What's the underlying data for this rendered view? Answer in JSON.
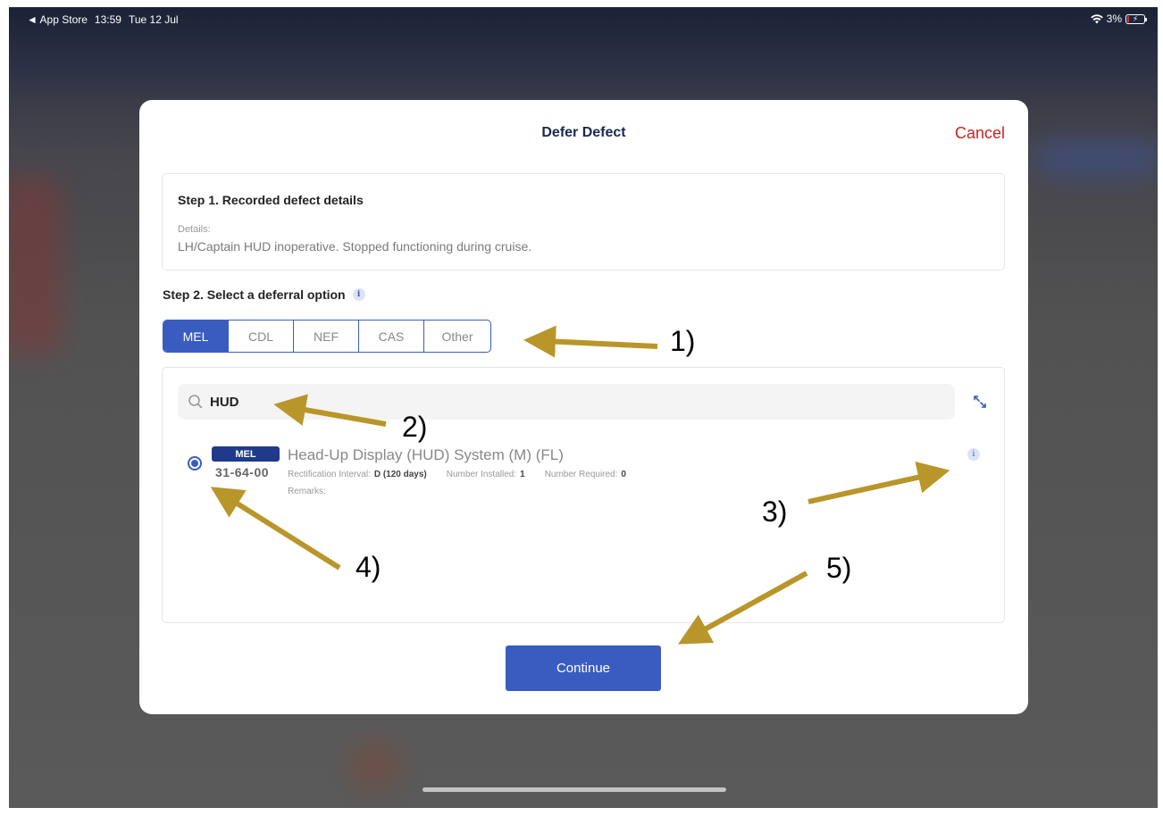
{
  "statusbar": {
    "back_app": "◄ App Store",
    "time": "13:59",
    "date": "Tue 12 Jul",
    "battery": "3%"
  },
  "modal": {
    "title": "Defer Defect",
    "cancel_label": "Cancel"
  },
  "step1": {
    "title": "Step 1. Recorded defect details",
    "details_label": "Details:",
    "details_text": "LH/Captain HUD inoperative. Stopped functioning during cruise."
  },
  "step2": {
    "title": "Step 2. Select a deferral option",
    "options": [
      {
        "label": "MEL",
        "active": true
      },
      {
        "label": "CDL",
        "active": false
      },
      {
        "label": "NEF",
        "active": false
      },
      {
        "label": "CAS",
        "active": false
      },
      {
        "label": "Other",
        "active": false
      }
    ]
  },
  "search": {
    "value": "HUD"
  },
  "result": {
    "badge": "MEL",
    "ata_code": "31-64-00",
    "title": "Head-Up Display (HUD) System (M) (FL)",
    "rect_label": "Rectification Interval:",
    "rect_value": "D (120 days)",
    "installed_label": "Number Installed:",
    "installed_value": "1",
    "required_label": "Number Required:",
    "required_value": "0",
    "remarks_label": "Remarks:",
    "selected": true
  },
  "continue_label": "Continue",
  "annotations": [
    "1)",
    "2)",
    "3)",
    "4)",
    "5)"
  ],
  "colors": {
    "accent": "#3a5cc0",
    "badge": "#1f3a8a",
    "cancel": "#cc2222",
    "arrow": "#b8962a"
  },
  "icons": {
    "search": "search-icon",
    "expand": "expand-icon",
    "info": "info-icon",
    "wifi": "wifi-icon",
    "battery": "battery-icon"
  }
}
